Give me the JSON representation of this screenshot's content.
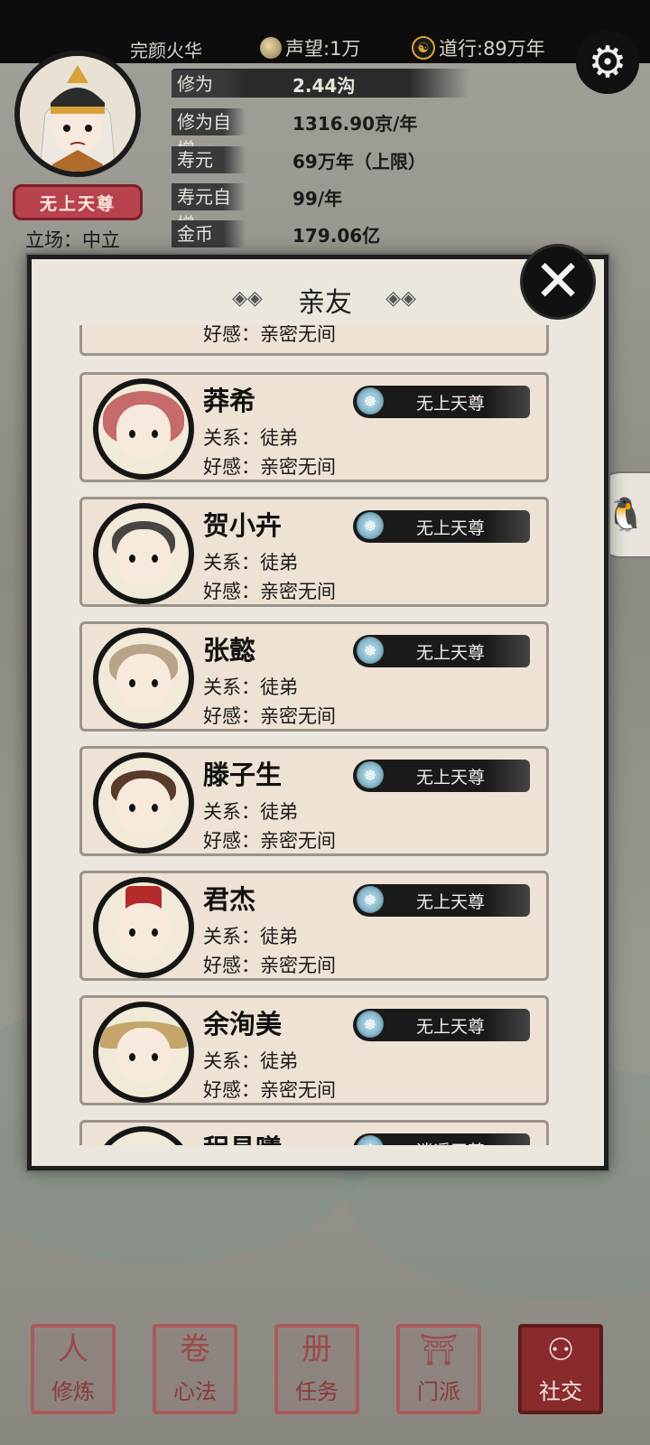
{
  "header": {
    "player_name": "完颜火华",
    "reputation_label": "声望:1万",
    "daoxing_label": "道行:89万年",
    "settings_icon": "gear-icon"
  },
  "profile": {
    "rank_badge": "无上天尊",
    "stance": "立场：中立",
    "stats": [
      {
        "label": "修为",
        "value": "2.44沟"
      },
      {
        "label": "修为自增",
        "value": "1316.90京/年"
      },
      {
        "label": "寿元",
        "value": "69万年（上限）"
      },
      {
        "label": "寿元自增",
        "value": "99/年"
      },
      {
        "label": "金币",
        "value": "179.06亿"
      }
    ]
  },
  "dialog": {
    "title": "亲友",
    "close_icon": "close-icon",
    "partial_top_text": "好感：亲密无间",
    "friends": [
      {
        "name": "莽希",
        "relation": "关系：徒弟",
        "favor": "好感：亲密无间",
        "rank": "无上天尊"
      },
      {
        "name": "贺小卉",
        "relation": "关系：徒弟",
        "favor": "好感：亲密无间",
        "rank": "无上天尊"
      },
      {
        "name": "张懿",
        "relation": "关系：徒弟",
        "favor": "好感：亲密无间",
        "rank": "无上天尊"
      },
      {
        "name": "滕子生",
        "relation": "关系：徒弟",
        "favor": "好感：亲密无间",
        "rank": "无上天尊"
      },
      {
        "name": "君杰",
        "relation": "关系：徒弟",
        "favor": "好感：亲密无间",
        "rank": "无上天尊"
      },
      {
        "name": "余洵美",
        "relation": "关系：徒弟",
        "favor": "好感：亲密无间",
        "rank": "无上天尊"
      },
      {
        "name": "程昌曦",
        "relation": "",
        "favor": "",
        "rank": "逍遥天尊"
      }
    ]
  },
  "bottom_nav": [
    {
      "label": "修炼",
      "icon": "cultivate-icon"
    },
    {
      "label": "心法",
      "icon": "scroll-icon"
    },
    {
      "label": "任务",
      "icon": "task-icon"
    },
    {
      "label": "门派",
      "icon": "sect-icon"
    },
    {
      "label": "社交",
      "icon": "social-icon",
      "active": true
    }
  ],
  "colors": {
    "panel_bg": "#ebe7df",
    "card_bg": "#ede2d4",
    "rank_badge_red": "#b8424d",
    "nav_active": "#8a2b2b"
  }
}
